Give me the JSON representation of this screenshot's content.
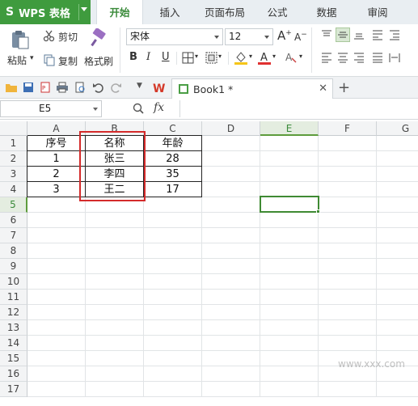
{
  "app": {
    "logo": "S",
    "name": "WPS 表格"
  },
  "ribbon_tabs": [
    {
      "label": "开始",
      "active": true
    },
    {
      "label": "插入",
      "active": false
    },
    {
      "label": "页面布局",
      "active": false
    },
    {
      "label": "公式",
      "active": false
    },
    {
      "label": "数据",
      "active": false
    },
    {
      "label": "审阅",
      "active": false
    }
  ],
  "clipboard": {
    "cut": "剪切",
    "paste": "粘贴",
    "copy": "复制",
    "format_painter": "格式刷"
  },
  "font": {
    "name": "宋体",
    "size": "12"
  },
  "format_buttons": {
    "bold": "B",
    "italic": "I",
    "underline": "U"
  },
  "colors": {
    "accent": "#3f9b3e",
    "fill": "#f5c518",
    "font_red": "#e03030",
    "highlight_box": "#d42b2b"
  },
  "document": {
    "tab_label": "Book1 *"
  },
  "formula_bar": {
    "cell_ref": "E5",
    "fx": "fx",
    "formula": ""
  },
  "columns": [
    "A",
    "B",
    "C",
    "D",
    "E",
    "F",
    "G"
  ],
  "selected_column": "E",
  "rows": [
    "1",
    "2",
    "3",
    "4",
    "5",
    "6",
    "7",
    "8",
    "9",
    "10",
    "11",
    "12",
    "13",
    "14",
    "15",
    "16",
    "17"
  ],
  "selected_row": "5",
  "table": {
    "header": [
      "序号",
      "名称",
      "年龄"
    ],
    "data": [
      [
        "1",
        "张三",
        "28"
      ],
      [
        "2",
        "李四",
        "35"
      ],
      [
        "3",
        "王二",
        "17"
      ]
    ]
  },
  "watermark": "www.xxx.com"
}
